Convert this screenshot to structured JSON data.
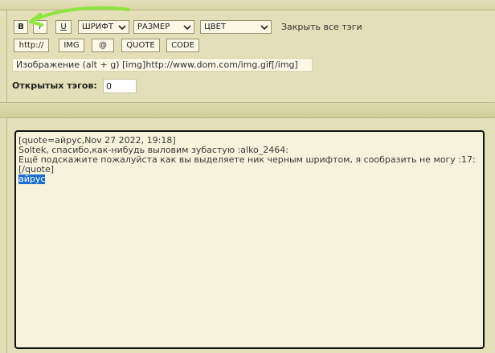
{
  "toolbar": {
    "bold_label": "B",
    "italic_label": "I",
    "underline_label": "U",
    "font_select": "ШРИФТ",
    "size_select": "РАЗМЕР",
    "color_select": "ЦВЕТ",
    "close_all_tags": "Закрыть все тэги",
    "http_label": "http://",
    "img_label": "IMG",
    "email_label": "@",
    "quote_label": "QUOTE",
    "code_label": "CODE"
  },
  "hint": "Изображение (alt + g) [img]http://www.dom.com/img.gif[/img]",
  "open_tags": {
    "label": "Открытых тэгов:",
    "value": "0"
  },
  "editor": {
    "lines": [
      "[quote=айрус,Nov 27 2022, 19:18]",
      "Soltek, спасибо,как-нибудь выловим зубастую :alko_2464:",
      "Ещё подскажите пожалуйста как вы выделяете ник черным шрифтом, я сообразить не могу :17:",
      "[/quote]"
    ],
    "selected_text": "айрус"
  },
  "colors": {
    "background": "#e3dfb8",
    "annotation_arrow": "#8ee53f",
    "selection": "#1b6fd1"
  }
}
